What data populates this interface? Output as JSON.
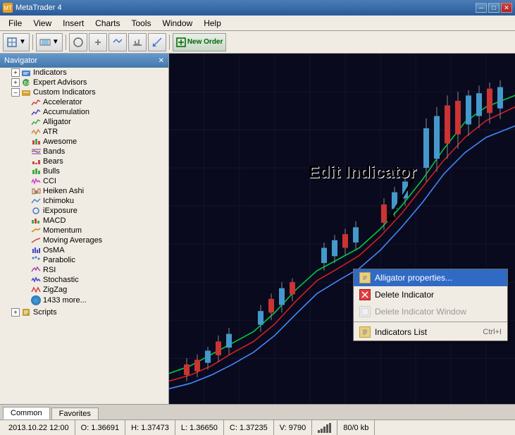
{
  "titleBar": {
    "title": "MetaTrader 4",
    "minimizeBtn": "─",
    "maximizeBtn": "□",
    "closeBtn": "✕"
  },
  "menuBar": {
    "items": [
      "File",
      "View",
      "Insert",
      "Charts",
      "Tools",
      "Window",
      "Help"
    ]
  },
  "toolbar": {
    "newOrderLabel": "New Order"
  },
  "navigator": {
    "title": "Navigator",
    "tree": {
      "indicators": "Indicators",
      "expertAdvisors": "Expert Advisors",
      "customIndicators": "Custom Indicators",
      "items": [
        "Accelerator",
        "Accumulation",
        "Alligator",
        "ATR",
        "Awesome",
        "Bands",
        "Bears",
        "Bulls",
        "CCI",
        "Heiken Ashi",
        "Ichimoku",
        "iExposure",
        "MACD",
        "Momentum",
        "Moving Averages",
        "OsMA",
        "Parabolic",
        "RSI",
        "Stochastic",
        "ZigZag"
      ],
      "moreLabel": "1433 more...",
      "scripts": "Scripts"
    }
  },
  "tabs": {
    "common": "Common",
    "favorites": "Favorites"
  },
  "contextMenu": {
    "alligatorProps": "Alligator properties...",
    "deleteIndicator": "Delete Indicator",
    "deleteIndicatorWindow": "Delete Indicator Window",
    "indicatorsList": "Indicators List",
    "indicatorsListShortcut": "Ctrl+I"
  },
  "editIndicator": {
    "label": "Edit Indicator"
  },
  "statusBar": {
    "datetime": "2013.10.22 12:00",
    "open": "O: 1.36691",
    "high": "H: 1.37473",
    "low": "L: 1.36650",
    "close": "C: 1.37235",
    "volume": "V: 9790",
    "extra": "80/0 kb"
  },
  "chart": {
    "backgroundColor": "#0a0a1e",
    "greenLine": "#00cc44",
    "redLine": "#cc2222",
    "blueLine": "#4488ff"
  }
}
